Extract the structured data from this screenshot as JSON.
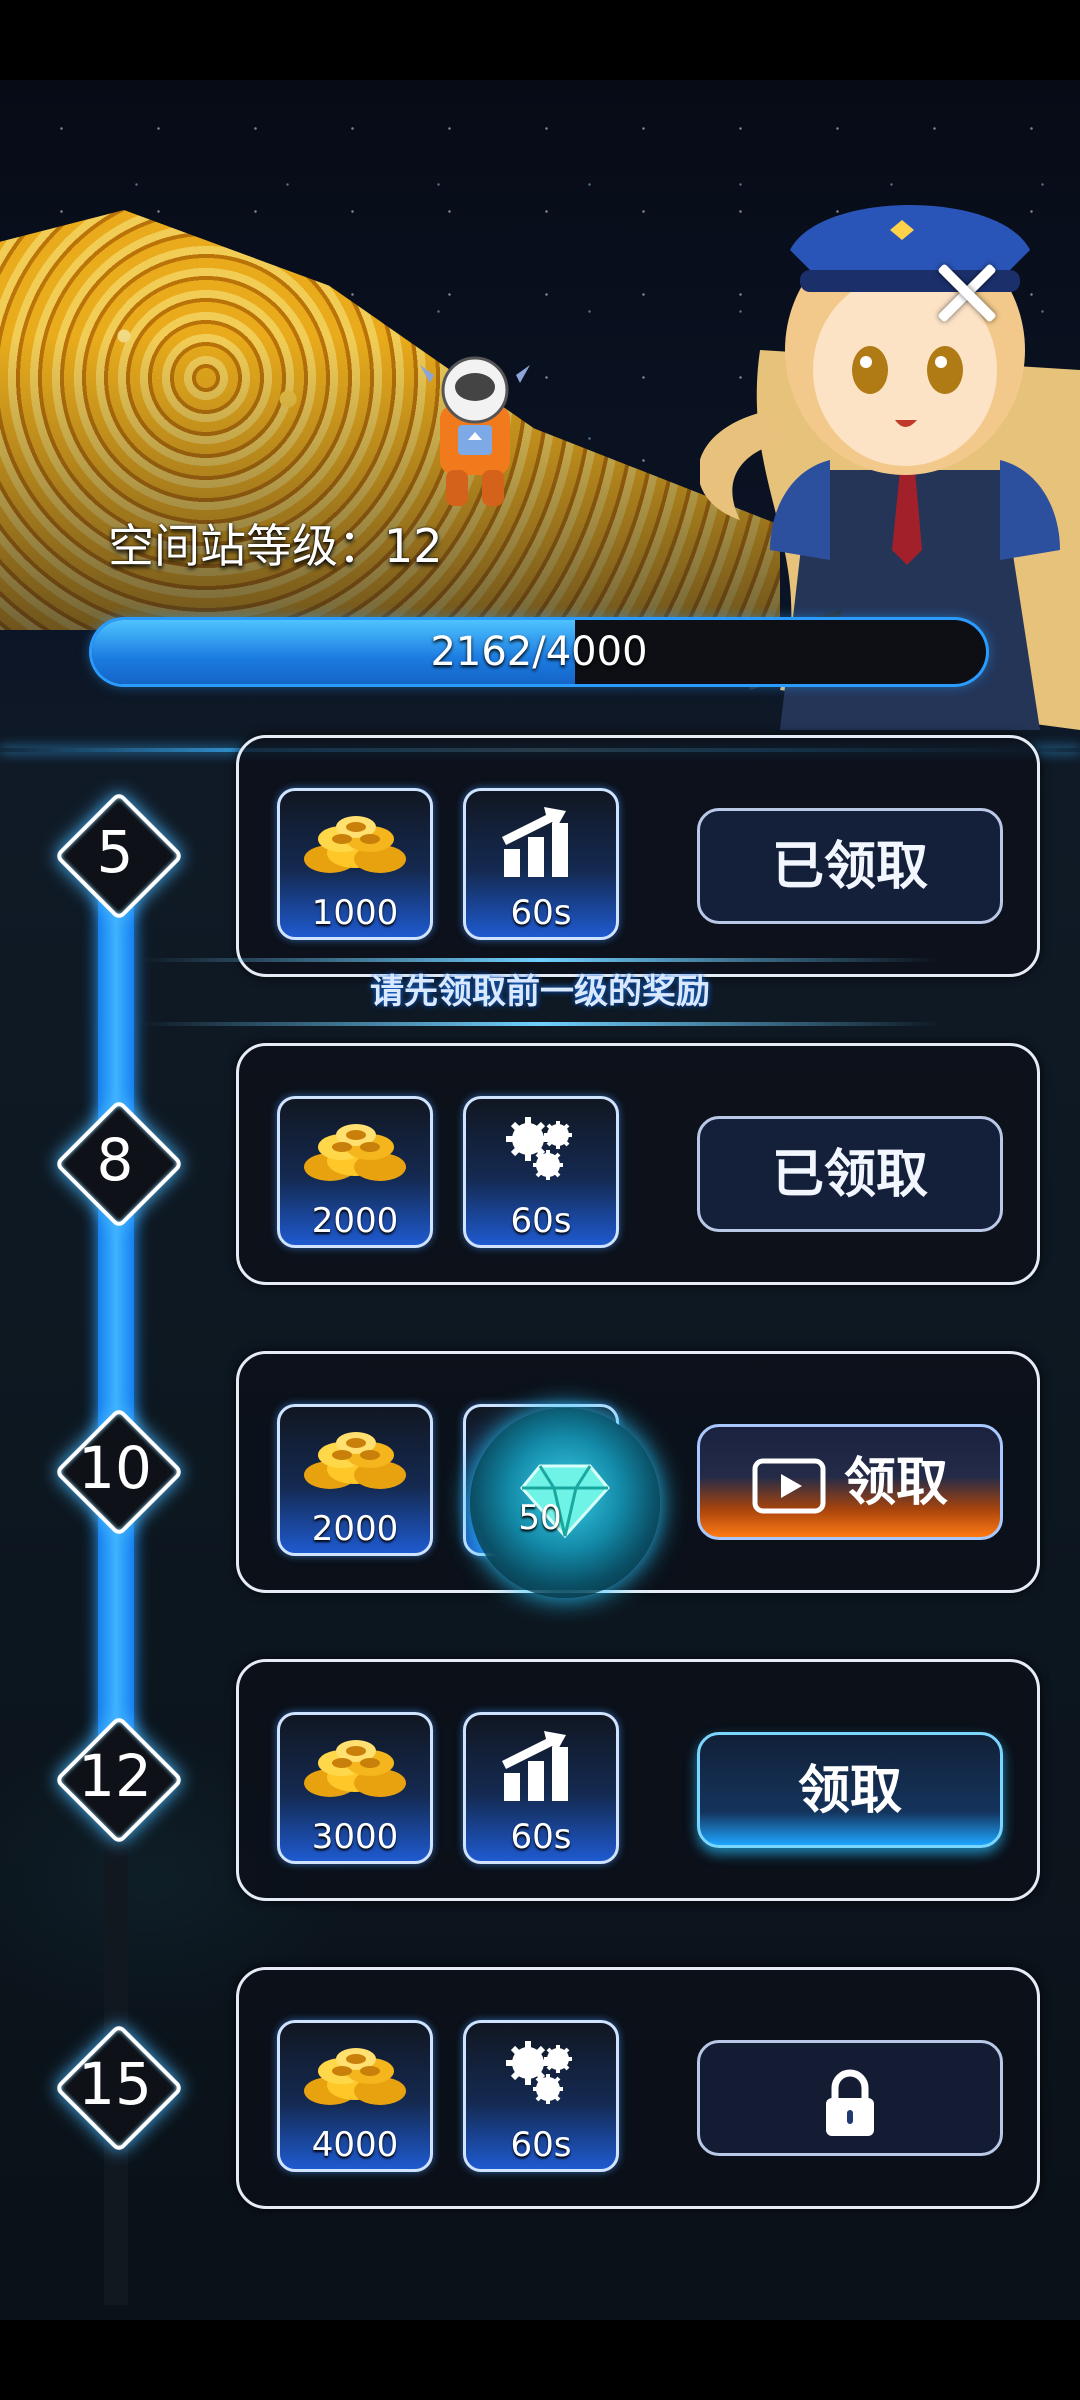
{
  "station": {
    "level_label": "空间站等级：12"
  },
  "progress": {
    "text": "2162/4000",
    "current": 2162,
    "max": 4000
  },
  "notice": "请先领取前一级的奖励",
  "levels": [
    {
      "level": "5",
      "coin": "1000",
      "bonus": "60s",
      "bonus_icon": "speed-bars-icon",
      "button": "已领取",
      "state": "claimed"
    },
    {
      "level": "8",
      "coin": "2000",
      "bonus": "60s",
      "bonus_icon": "gears-icon",
      "button": "已领取",
      "state": "claimed"
    },
    {
      "level": "10",
      "coin": "2000",
      "bonus": "50",
      "bonus_icon": "gem-icon",
      "button": "领取",
      "state": "watch-ad"
    },
    {
      "level": "12",
      "coin": "3000",
      "bonus": "60s",
      "bonus_icon": "speed-bars-icon",
      "button": "领取",
      "state": "claimable"
    },
    {
      "level": "15",
      "coin": "4000",
      "bonus": "60s",
      "bonus_icon": "gears-icon",
      "button": "",
      "state": "locked"
    }
  ],
  "colors": {
    "accent": "#2a9cff",
    "ad_button": "#ff7a14",
    "panel_border": "#e6ecf5"
  }
}
